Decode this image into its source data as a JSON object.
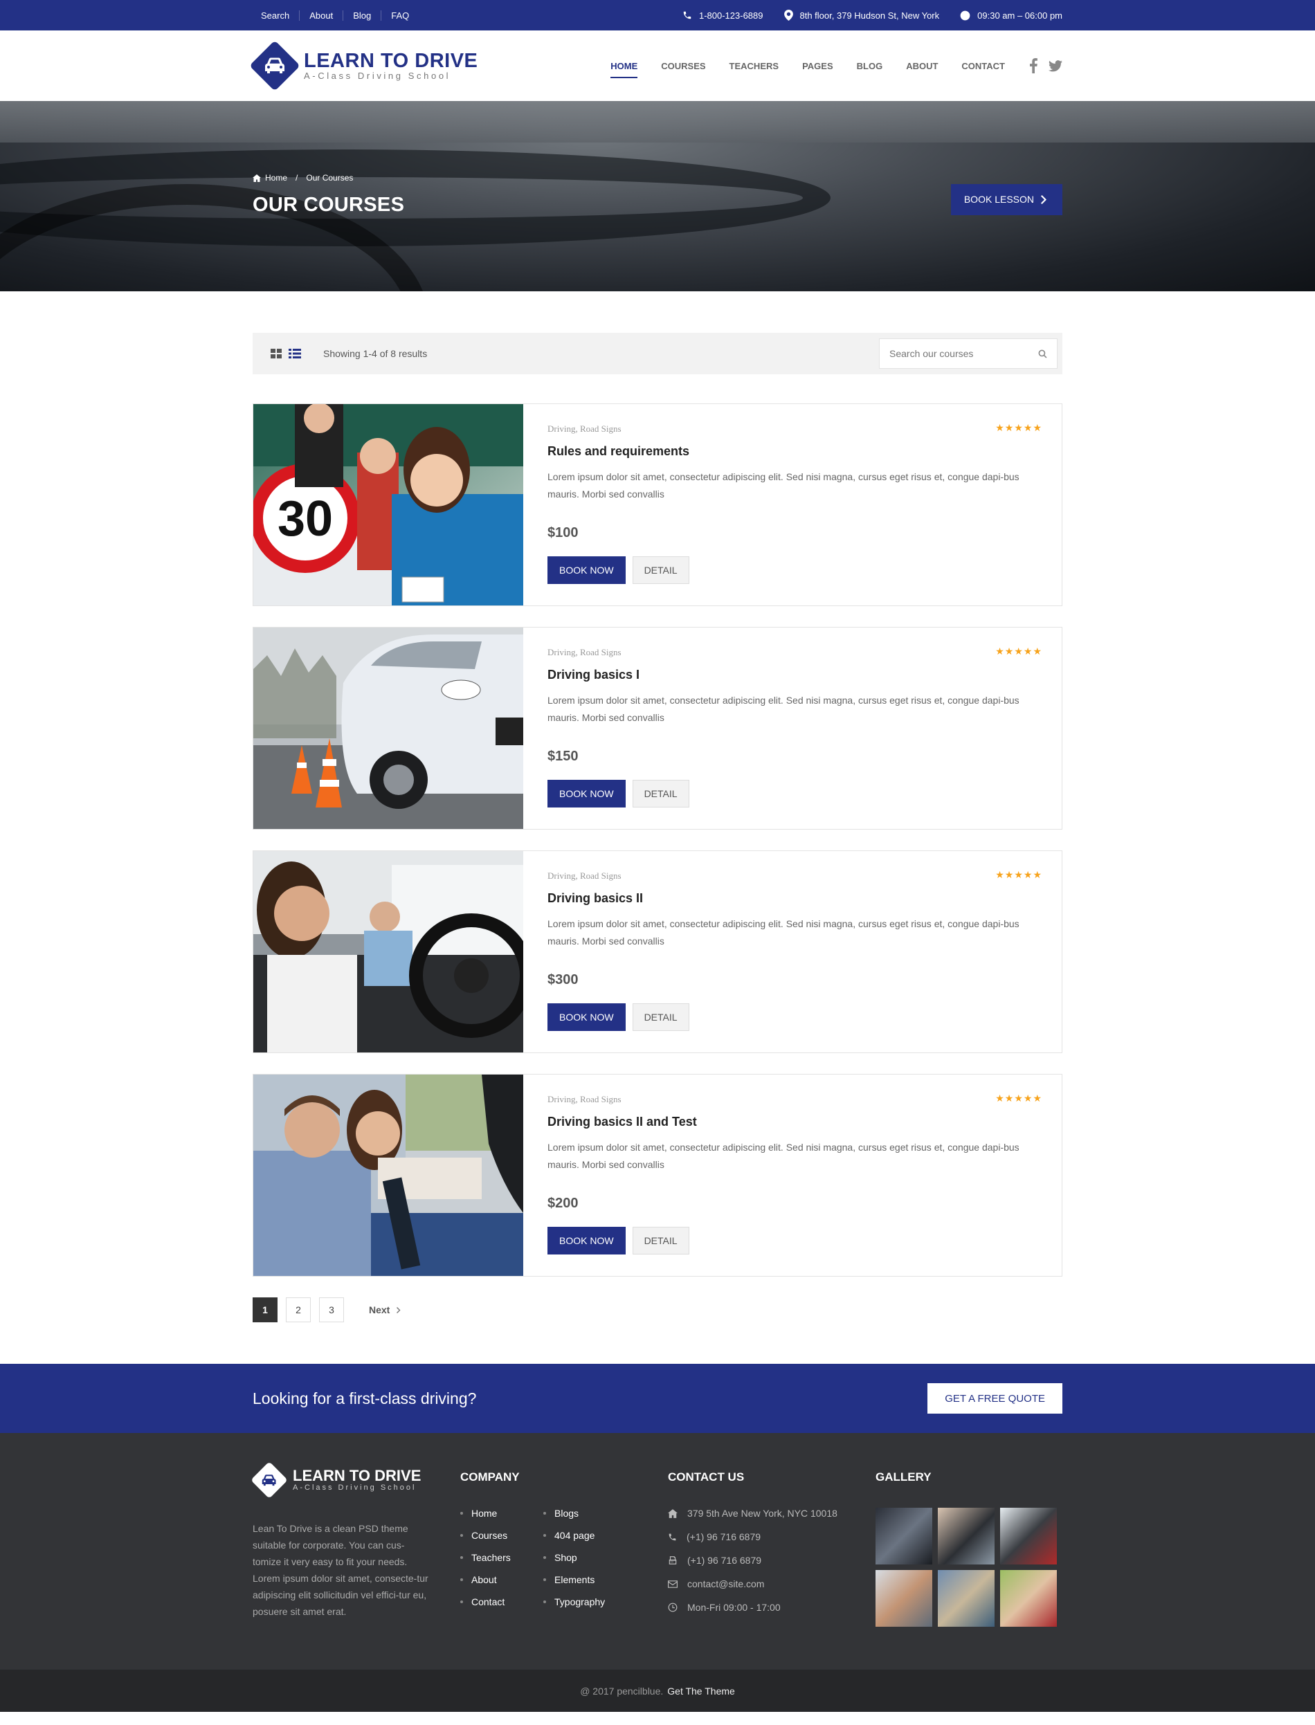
{
  "topbar": {
    "links": [
      "Search",
      "About",
      "Blog",
      "FAQ"
    ],
    "phone": "1-800-123-6889",
    "address": "8th floor, 379 Hudson St, New York",
    "hours": "09:30 am – 06:00 pm"
  },
  "brand": {
    "name": "LEARN TO DRIVE",
    "tagline": "A-Class Driving School",
    "color": "#233186"
  },
  "nav": {
    "items": [
      "HOME",
      "COURSES",
      "TEACHERS",
      "PAGES",
      "BLOG",
      "ABOUT",
      "CONTACT"
    ],
    "active": "HOME",
    "social": [
      "facebook-icon",
      "twitter-icon"
    ]
  },
  "hero": {
    "breadcrumb_home": "Home",
    "breadcrumb_sep": "/",
    "breadcrumb_current": "Our Courses",
    "title": "OUR COURSES",
    "button": "BOOK LESSON"
  },
  "filter": {
    "results": "Showing 1-4 of 8 results",
    "search_placeholder": "Search our courses"
  },
  "courses": [
    {
      "categories": "Driving, Road Signs",
      "title": "Rules and requirements",
      "description": "Lorem ipsum dolor sit amet, consectetur adipiscing elit. Sed nisi magna, cursus eget risus et, congue dapi-bus mauris. Morbi sed convallis",
      "price": "$100",
      "stars": "★★★★★",
      "book": "BOOK NOW",
      "detail": "DETAIL"
    },
    {
      "categories": "Driving, Road Signs",
      "title": "Driving basics I",
      "description": "Lorem ipsum dolor sit amet, consectetur adipiscing elit. Sed nisi magna, cursus eget risus et, congue dapi-bus mauris. Morbi sed convallis",
      "price": "$150",
      "stars": "★★★★★",
      "book": "BOOK NOW",
      "detail": "DETAIL"
    },
    {
      "categories": "Driving, Road Signs",
      "title": "Driving basics II",
      "description": "Lorem ipsum dolor sit amet, consectetur adipiscing elit. Sed nisi magna, cursus eget risus et, congue dapi-bus mauris. Morbi sed convallis",
      "price": "$300",
      "stars": "★★★★★",
      "book": "BOOK NOW",
      "detail": "DETAIL"
    },
    {
      "categories": "Driving, Road Signs",
      "title": "Driving basics II and Test",
      "description": "Lorem ipsum dolor sit amet, consectetur adipiscing elit. Sed nisi magna, cursus eget risus et, congue dapi-bus mauris. Morbi sed convallis",
      "price": "$200",
      "stars": "★★★★★",
      "book": "BOOK NOW",
      "detail": "DETAIL"
    }
  ],
  "pagination": {
    "pages": [
      "1",
      "2",
      "3"
    ],
    "active": "1",
    "next": "Next"
  },
  "cta": {
    "text": "Looking for a first-class driving?",
    "button": "GET A FREE QUOTE"
  },
  "footer": {
    "about": "Lean To Drive is a clean PSD theme suitable for corporate. You can cus-tomize it very easy to fit your needs. Lorem ipsum dolor sit amet, consecte-tur adipiscing elit sollicitudin vel effici-tur eu, posuere sit amet erat.",
    "company_title": "COMPANY",
    "company_col1": [
      "Home",
      "Courses",
      "Teachers",
      "About",
      "Contact"
    ],
    "company_col2": [
      "Blogs",
      "404 page",
      "Shop",
      "Elements",
      "Typography"
    ],
    "contact_title": "CONTACT US",
    "contact": {
      "address": "379 5th Ave  New York, NYC 10018",
      "phone": "(+1) 96 716 6879",
      "fax": "(+1) 96 716 6879",
      "email": "contact@site.com",
      "hours": "Mon-Fri 09:00 - 17:00"
    },
    "gallery_title": "GALLERY",
    "copyright": "@ 2017 pencilblue.",
    "copyright_link": "Get The Theme"
  }
}
